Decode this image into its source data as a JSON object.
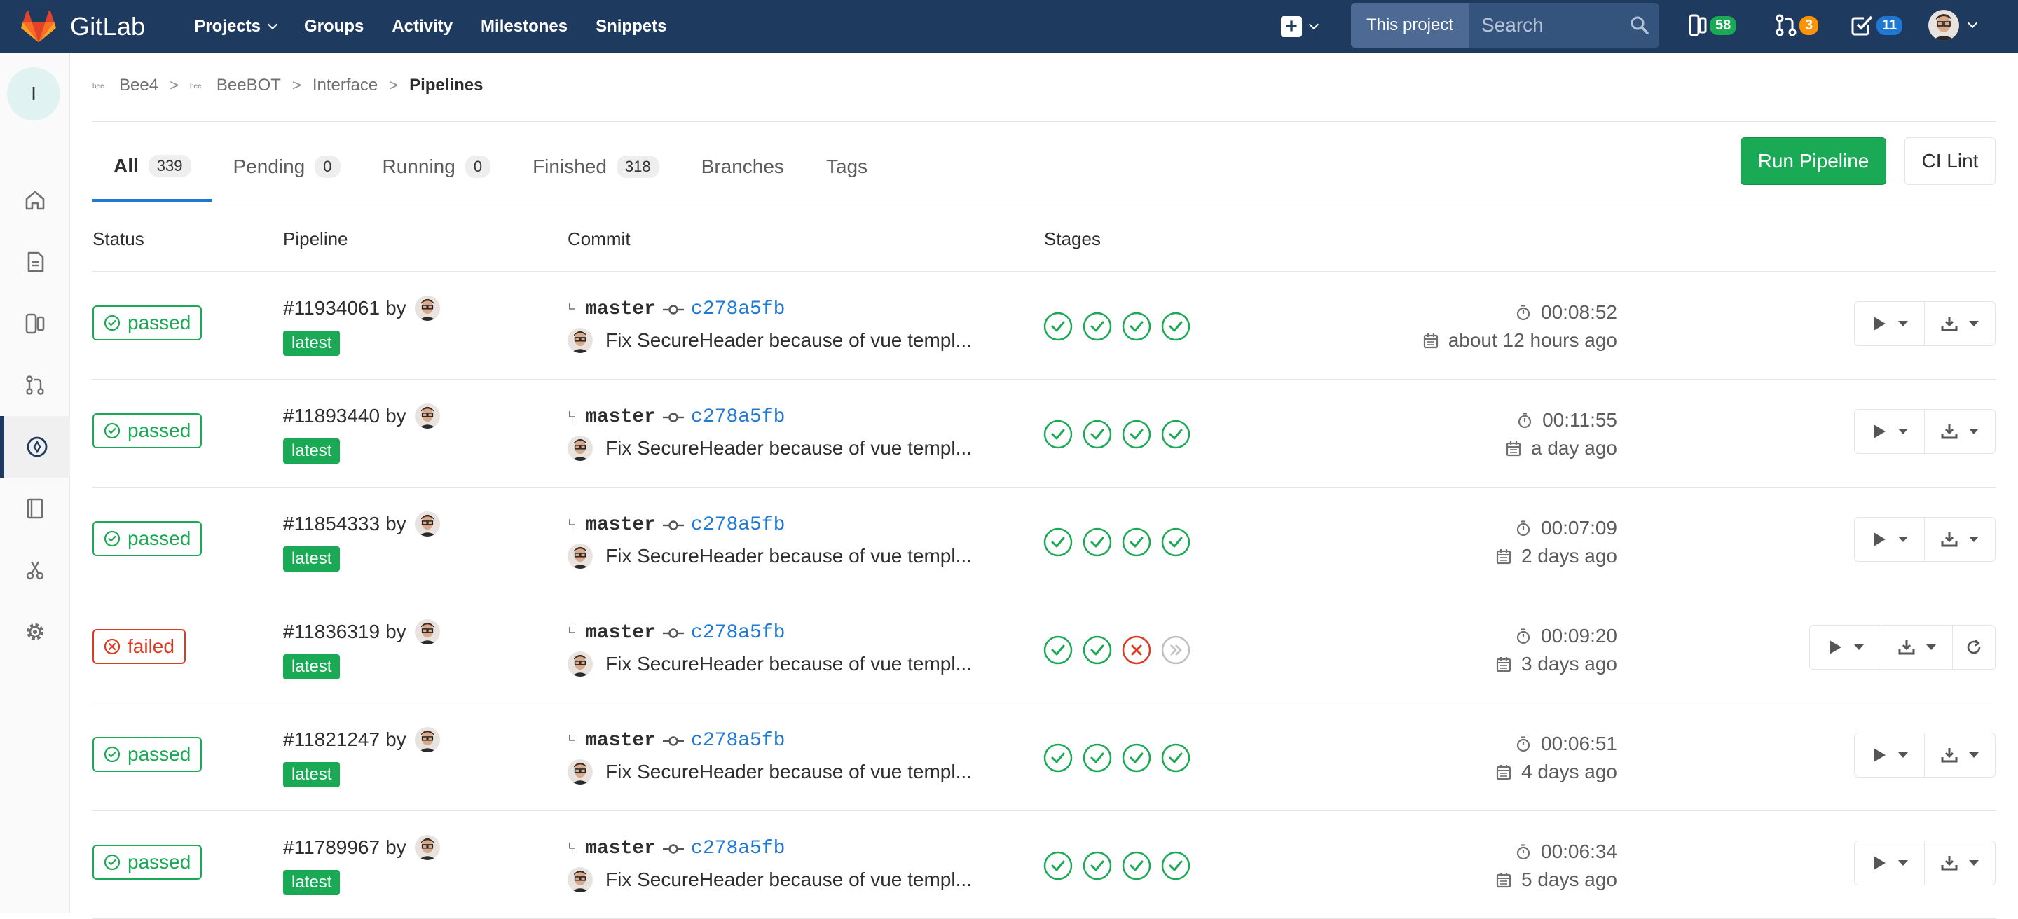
{
  "brand": {
    "name": "GitLab"
  },
  "nav": {
    "links": [
      {
        "label": "Projects",
        "dropdown": true
      },
      {
        "label": "Groups",
        "dropdown": false
      },
      {
        "label": "Activity",
        "dropdown": false
      },
      {
        "label": "Milestones",
        "dropdown": false
      },
      {
        "label": "Snippets",
        "dropdown": false
      }
    ],
    "search_scope": "This project",
    "search_placeholder": "Search",
    "issues_count": "58",
    "merge_requests_count": "3",
    "todos_count": "11"
  },
  "sidebar": {
    "project_initial": "I",
    "items": [
      "home-icon",
      "repository-icon",
      "issues-icon",
      "merge-requests-icon",
      "ci-cd-icon",
      "wiki-icon",
      "snippets-icon",
      "settings-icon"
    ]
  },
  "breadcrumb": {
    "group": "Bee4",
    "subgroup": "BeeBOT",
    "project": "Interface",
    "current": "Pipelines"
  },
  "tabs": [
    {
      "label": "All",
      "count": "339"
    },
    {
      "label": "Pending",
      "count": "0"
    },
    {
      "label": "Running",
      "count": "0"
    },
    {
      "label": "Finished",
      "count": "318"
    },
    {
      "label": "Branches",
      "count": null
    },
    {
      "label": "Tags",
      "count": null
    }
  ],
  "buttons": {
    "run_pipeline": "Run Pipeline",
    "ci_lint": "CI Lint"
  },
  "table": {
    "headers": {
      "status": "Status",
      "pipeline": "Pipeline",
      "commit": "Commit",
      "stages": "Stages"
    },
    "rows": [
      {
        "status": "passed",
        "id": "#11934061",
        "by": "by",
        "tag": "latest",
        "branch": "master",
        "sha": "c278a5fb",
        "message": "Fix SecureHeader because of vue templ...",
        "stages": [
          "success",
          "success",
          "success",
          "success"
        ],
        "duration": "00:08:52",
        "finished": "about 12 hours ago",
        "retry": false
      },
      {
        "status": "passed",
        "id": "#11893440",
        "by": "by",
        "tag": "latest",
        "branch": "master",
        "sha": "c278a5fb",
        "message": "Fix SecureHeader because of vue templ...",
        "stages": [
          "success",
          "success",
          "success",
          "success"
        ],
        "duration": "00:11:55",
        "finished": "a day ago",
        "retry": false
      },
      {
        "status": "passed",
        "id": "#11854333",
        "by": "by",
        "tag": "latest",
        "branch": "master",
        "sha": "c278a5fb",
        "message": "Fix SecureHeader because of vue templ...",
        "stages": [
          "success",
          "success",
          "success",
          "success"
        ],
        "duration": "00:07:09",
        "finished": "2 days ago",
        "retry": false
      },
      {
        "status": "failed",
        "id": "#11836319",
        "by": "by",
        "tag": "latest",
        "branch": "master",
        "sha": "c278a5fb",
        "message": "Fix SecureHeader because of vue templ...",
        "stages": [
          "success",
          "success",
          "failed",
          "skipped"
        ],
        "duration": "00:09:20",
        "finished": "3 days ago",
        "retry": true
      },
      {
        "status": "passed",
        "id": "#11821247",
        "by": "by",
        "tag": "latest",
        "branch": "master",
        "sha": "c278a5fb",
        "message": "Fix SecureHeader because of vue templ...",
        "stages": [
          "success",
          "success",
          "success",
          "success"
        ],
        "duration": "00:06:51",
        "finished": "4 days ago",
        "retry": false
      },
      {
        "status": "passed",
        "id": "#11789967",
        "by": "by",
        "tag": "latest",
        "branch": "master",
        "sha": "c278a5fb",
        "message": "Fix SecureHeader because of vue templ...",
        "stages": [
          "success",
          "success",
          "success",
          "success"
        ],
        "duration": "00:06:34",
        "finished": "5 days ago",
        "retry": false
      }
    ]
  },
  "colors": {
    "navbar": "#1f3a5f",
    "success": "#1aaa55",
    "failed": "#db3b21",
    "link": "#1f78d1"
  }
}
